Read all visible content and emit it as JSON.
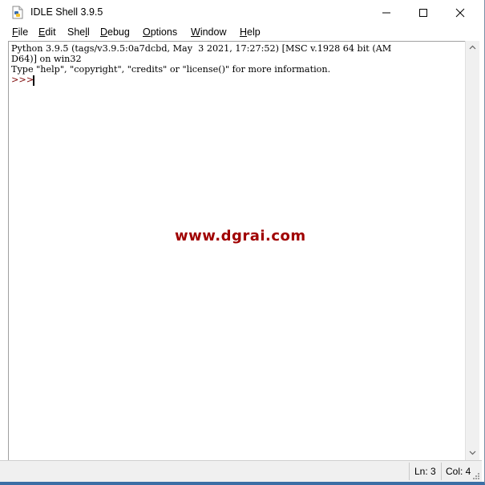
{
  "window": {
    "title": "IDLE Shell 3.9.5",
    "accent_color": "#3b6ea5"
  },
  "title_controls": {
    "minimize_icon": "minimize-icon",
    "maximize_icon": "maximize-icon",
    "close_icon": "close-icon"
  },
  "menu": {
    "items": [
      {
        "first": "F",
        "rest": "ile"
      },
      {
        "first": "E",
        "rest": "dit"
      },
      {
        "first": "S",
        "rest": "hell",
        "pre": "She",
        "ul": "l",
        "post": "l"
      },
      {
        "first": "D",
        "rest": "ebug"
      },
      {
        "first": "O",
        "rest": "ptions"
      },
      {
        "first": "W",
        "rest": "indow"
      },
      {
        "first": "H",
        "rest": "elp"
      }
    ]
  },
  "shell": {
    "lines": [
      "Python 3.9.5 (tags/v3.9.5:0a7dcbd, May  3 2021, 17:27:52) [MSC v.1928 64 bit (AM",
      "D64)] on win32",
      "Type \"help\", \"copyright\", \"credits\" or \"license()\" for more information."
    ],
    "prompt": ">>> ",
    "prompt_color": "#7a0000"
  },
  "watermark": {
    "text": "www.dgrai.com",
    "color": "#a00000"
  },
  "status": {
    "line": "Ln: 3",
    "col": "Col: 4"
  }
}
